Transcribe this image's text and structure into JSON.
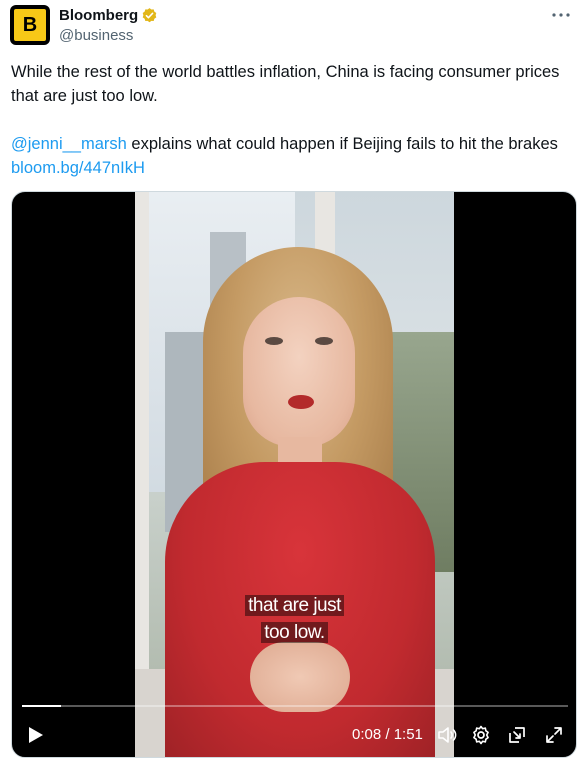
{
  "author": {
    "display_name": "Bloomberg",
    "handle": "@business",
    "avatar_letter": "B",
    "avatar_color": "#f7c817",
    "verified_badge_color": "#e2b719"
  },
  "tweet": {
    "paragraph1": "While the rest of the world battles inflation, China is facing consumer prices that are just too low.",
    "mention": "@jenni__marsh",
    "paragraph2_middle": " explains what could happen if Beijing fails to hit the brakes ",
    "link": "bloom.bg/447nIkH",
    "link_color": "#1d9bf0"
  },
  "video": {
    "caption_line1": "that are just",
    "caption_line2": "too low.",
    "time_display": "0:08 / 1:51",
    "progress_fraction": 0.072
  },
  "icons": {
    "more": "more-icon",
    "play": "play-icon",
    "volume": "volume-icon",
    "settings": "settings-icon",
    "pip": "pip-icon",
    "fullscreen": "fullscreen-icon"
  }
}
